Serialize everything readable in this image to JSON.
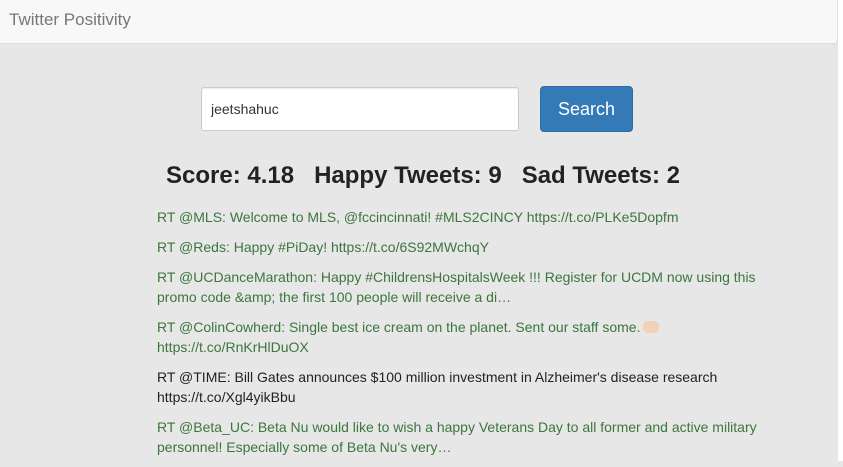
{
  "navbar": {
    "brand": "Twitter Positivity"
  },
  "search": {
    "value": "jeetshahuc",
    "button_label": "Search"
  },
  "stats": {
    "score_text": "Score: 4.18",
    "happy_text": "Happy Tweets: 9",
    "sad_text": "Sad Tweets: 2"
  },
  "tweets": [
    {
      "text": "RT @MLS: Welcome to MLS, @fccincinnati! #MLS2CINCY https://t.co/PLKe5Dopfm",
      "sentiment": "positive"
    },
    {
      "text": "RT @Reds: Happy #PiDay! https://t.co/6S92MWchqY",
      "sentiment": "positive"
    },
    {
      "text": "RT @UCDanceMarathon: Happy #ChildrensHospitalsWeek !!! Register for UCDM now using this promo code &amp; the first 100 people will receive a di…",
      "sentiment": "positive"
    },
    {
      "text": "RT @ColinCowherd: Single best ice cream on the planet. Sent our staff some.",
      "sentiment": "positive",
      "emoji": "fist-bump-emoji",
      "text2": "https://t.co/RnKrHlDuOX"
    },
    {
      "text": "RT @TIME: Bill Gates announces $100 million investment in Alzheimer's disease research https://t.co/Xgl4yikBbu",
      "sentiment": "neutral"
    },
    {
      "text": "RT @Beta_UC: Beta Nu would like to wish a happy Veterans Day to all former and active military personnel! Especially some of Beta Nu's very…",
      "sentiment": "positive"
    }
  ],
  "colors": {
    "positive": "#3c763d",
    "neutral": "#222222",
    "button": "#337ab7",
    "background": "#e7e7e7"
  }
}
